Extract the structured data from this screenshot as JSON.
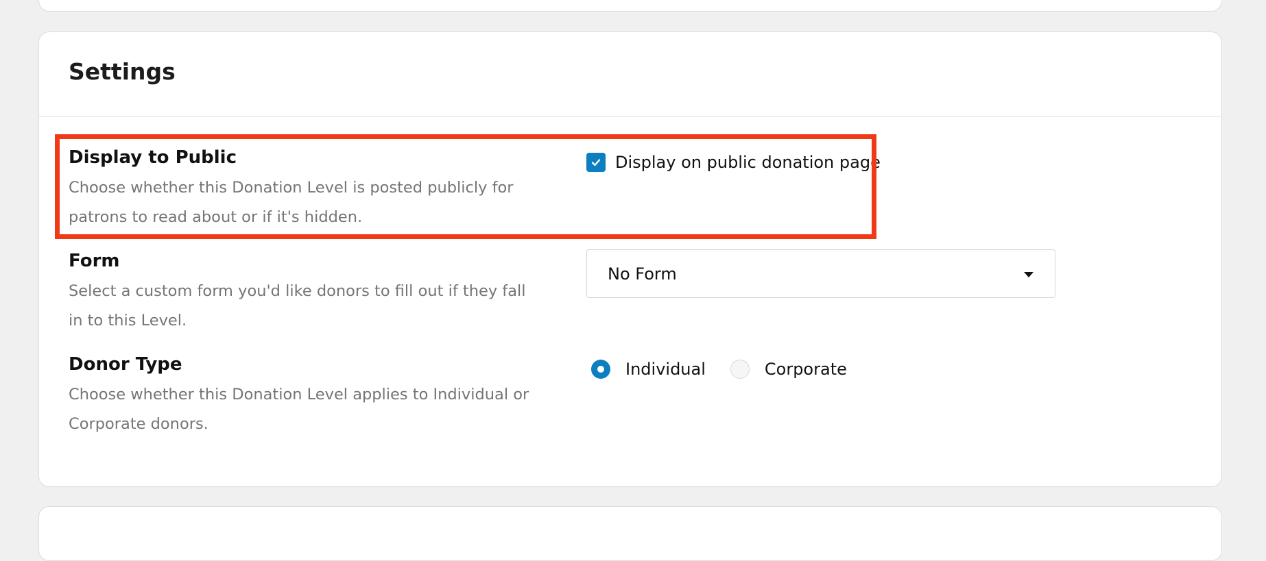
{
  "settings": {
    "title": "Settings",
    "display_to_public": {
      "label": "Display to Public",
      "description": "Choose whether this Donation Level is posted publicly for patrons to read about or if it's hidden.",
      "checkbox_label": "Display on public donation page",
      "checked": true
    },
    "form": {
      "label": "Form",
      "description": "Select a custom form you'd like donors to fill out if they fall in to this Level.",
      "selected_value": "No Form"
    },
    "donor_type": {
      "label": "Donor Type",
      "description": "Choose whether this Donation Level applies to Individual or Corporate donors.",
      "options": [
        "Individual",
        "Corporate"
      ],
      "selected": "Individual"
    }
  },
  "colors": {
    "accent": "#0b7fc0",
    "highlight": "#f03a17"
  },
  "icons": {
    "checkbox": "checkmark-icon",
    "select": "caret-down-icon"
  }
}
